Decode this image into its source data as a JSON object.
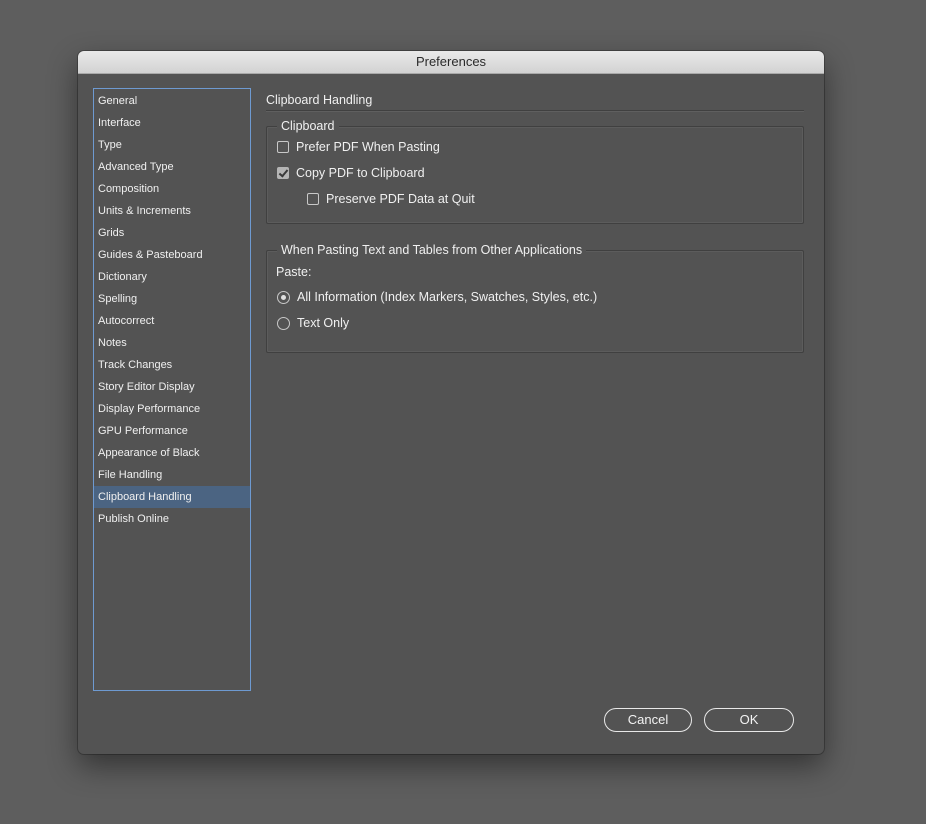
{
  "window": {
    "title": "Preferences"
  },
  "sidebar": {
    "items": [
      {
        "label": "General"
      },
      {
        "label": "Interface"
      },
      {
        "label": "Type"
      },
      {
        "label": "Advanced Type"
      },
      {
        "label": "Composition"
      },
      {
        "label": "Units & Increments"
      },
      {
        "label": "Grids"
      },
      {
        "label": "Guides & Pasteboard"
      },
      {
        "label": "Dictionary"
      },
      {
        "label": "Spelling"
      },
      {
        "label": "Autocorrect"
      },
      {
        "label": "Notes"
      },
      {
        "label": "Track Changes"
      },
      {
        "label": "Story Editor Display"
      },
      {
        "label": "Display Performance"
      },
      {
        "label": "GPU Performance"
      },
      {
        "label": "Appearance of Black"
      },
      {
        "label": "File Handling"
      },
      {
        "label": "Clipboard Handling",
        "selected": true
      },
      {
        "label": "Publish Online"
      }
    ]
  },
  "panel": {
    "title": "Clipboard Handling",
    "clipboard_group": {
      "legend": "Clipboard",
      "prefer_pdf": {
        "label": "Prefer PDF When Pasting",
        "checked": false
      },
      "copy_pdf": {
        "label": "Copy PDF to Clipboard",
        "checked": true
      },
      "preserve_pdf": {
        "label": "Preserve PDF Data at Quit",
        "checked": false
      }
    },
    "pasting_group": {
      "legend": "When Pasting Text and Tables from Other Applications",
      "paste_label": "Paste:",
      "all_info": {
        "label": "All Information (Index Markers, Swatches, Styles, etc.)",
        "selected": true
      },
      "text_only": {
        "label": "Text Only",
        "selected": false
      }
    }
  },
  "buttons": {
    "cancel": "Cancel",
    "ok": "OK"
  },
  "colors": {
    "selection": "#4b6482",
    "sidebar_border": "#6e9ad1",
    "window_bg": "#535353",
    "desktop_bg": "#5e5e5e"
  }
}
